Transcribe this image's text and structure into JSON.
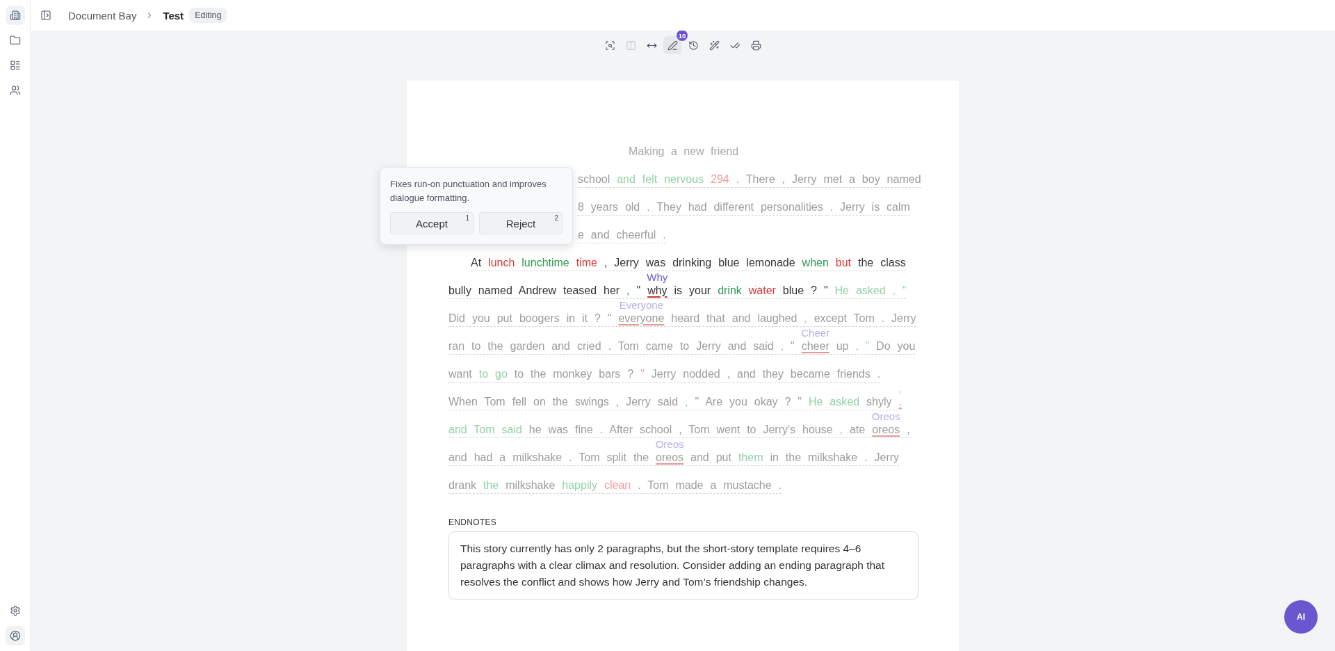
{
  "sidebar": {
    "items": [
      {
        "kind": "building",
        "selected": true
      },
      {
        "kind": "folder",
        "selected": false
      },
      {
        "kind": "layout",
        "selected": false
      },
      {
        "kind": "users",
        "selected": false
      }
    ],
    "bottom_items": [
      {
        "kind": "settings",
        "selected": false
      },
      {
        "kind": "account",
        "selected": true
      }
    ]
  },
  "header": {
    "breadcrumb": [
      "Document Bay",
      "Test"
    ],
    "status": "Editing"
  },
  "toolbar": [
    {
      "kind": "image-search",
      "selected": false,
      "disabled": false
    },
    {
      "kind": "columns",
      "selected": false,
      "disabled": true
    },
    {
      "kind": "width",
      "selected": false,
      "disabled": false
    },
    {
      "kind": "pen",
      "selected": true,
      "disabled": false,
      "badge": "10"
    },
    {
      "kind": "history",
      "selected": false,
      "disabled": false
    },
    {
      "kind": "wand",
      "selected": false,
      "disabled": false
    },
    {
      "kind": "check",
      "selected": false,
      "disabled": false
    },
    {
      "kind": "print",
      "selected": false,
      "disabled": false
    }
  ],
  "document": {
    "title": {
      "text": "Making a new friend",
      "active": false
    },
    "paragraphs": [
      {
        "kind": "partly_covered",
        "lines": [
          {
            "segments": [
              {
                "active": false,
                "tokens": [
                  {
                    "kind": "text",
                    "text": "school"
                  },
                  {
                    "kind": "insert",
                    "text": "and felt nervous"
                  },
                  {
                    "kind": "delete",
                    "text": "294"
                  },
                  {
                    "kind": "text",
                    "text": ". There , Jerry met a boy named"
                  }
                ]
              }
            ]
          },
          {
            "segments": [
              {
                "active": false,
                "tokens": [
                  {
                    "kind": "text",
                    "text": "8 years old . They had different personalities . Jerry is calm"
                  }
                ]
              }
            ]
          },
          {
            "segments": [
              {
                "active": false,
                "tokens": [
                  {
                    "kind": "text",
                    "text": "e and cheerful ."
                  }
                ]
              }
            ]
          }
        ]
      },
      {
        "kind": "indented",
        "lines": [
          {
            "segments": [
              {
                "active": true,
                "tokens": [
                  {
                    "kind": "text",
                    "text": "At"
                  },
                  {
                    "kind": "delete",
                    "text": "lunch"
                  },
                  {
                    "kind": "insert",
                    "text": "lunchtime"
                  },
                  {
                    "kind": "delete",
                    "text": "time"
                  },
                  {
                    "kind": "text",
                    "text": ", Jerry was drinking blue lemonade"
                  },
                  {
                    "kind": "insert",
                    "text": "when"
                  },
                  {
                    "kind": "delete",
                    "text": "but"
                  },
                  {
                    "kind": "text",
                    "text": "the class"
                  }
                ]
              }
            ]
          },
          {
            "segments": [
              {
                "active": true,
                "tokens": [
                  {
                    "kind": "text",
                    "text": "bully named Andrew teased her"
                  },
                  {
                    "kind": "insert",
                    "text": ","
                  },
                  {
                    "kind": "text",
                    "text": "\""
                  },
                  {
                    "kind": "replace",
                    "text": "why",
                    "suggestion": "Why"
                  },
                  {
                    "kind": "text",
                    "text": "is your"
                  },
                  {
                    "kind": "insert",
                    "text": "drink"
                  },
                  {
                    "kind": "delete",
                    "text": "water"
                  },
                  {
                    "kind": "text",
                    "text": "blue ? \""
                  }
                ]
              },
              {
                "active": false,
                "tokens": [
                  {
                    "kind": "insert",
                    "text": "He asked , “"
                  }
                ]
              }
            ]
          },
          {
            "segments": [
              {
                "active": false,
                "tokens": [
                  {
                    "kind": "text",
                    "text": "Did you put boogers in it ? \""
                  },
                  {
                    "kind": "replace",
                    "text": "everyone",
                    "suggestion": "Everyone"
                  },
                  {
                    "kind": "text",
                    "text": "heard that and laughed"
                  },
                  {
                    "kind": "insert",
                    "text": ","
                  },
                  {
                    "kind": "text",
                    "text": "except Tom . Jerry"
                  }
                ]
              }
            ]
          },
          {
            "segments": [
              {
                "active": false,
                "tokens": [
                  {
                    "kind": "text",
                    "text": "ran to the garden and cried . Tom came to Jerry and said"
                  },
                  {
                    "kind": "insert",
                    "text": ","
                  },
                  {
                    "kind": "text",
                    "text": "\""
                  },
                  {
                    "kind": "replace",
                    "text": "cheer",
                    "suggestion": "Cheer"
                  },
                  {
                    "kind": "text",
                    "text": "up ."
                  },
                  {
                    "kind": "insert",
                    "text": "”"
                  },
                  {
                    "kind": "text",
                    "text": "Do you"
                  }
                ]
              }
            ]
          },
          {
            "segments": [
              {
                "active": false,
                "tokens": [
                  {
                    "kind": "text",
                    "text": "want"
                  },
                  {
                    "kind": "insert",
                    "text": "to go"
                  },
                  {
                    "kind": "text",
                    "text": "to the monkey bars ?"
                  },
                  {
                    "kind": "delete",
                    "text": "\""
                  },
                  {
                    "kind": "text",
                    "text": "Jerry nodded , and they became friends ."
                  }
                ]
              }
            ]
          },
          {
            "segments": [
              {
                "active": false,
                "tokens": [
                  {
                    "kind": "text",
                    "text": "When Tom fell on the swings , Jerry said"
                  },
                  {
                    "kind": "insert",
                    "text": ","
                  },
                  {
                    "kind": "text",
                    "text": "\" Are you okay ? \""
                  },
                  {
                    "kind": "insert",
                    "text": "He asked"
                  },
                  {
                    "kind": "text",
                    "text": "shyly"
                  },
                  {
                    "kind": "replace",
                    "text": ".",
                    "suggestion": ","
                  }
                ]
              }
            ]
          },
          {
            "segments": [
              {
                "active": false,
                "tokens": [
                  {
                    "kind": "insert",
                    "text": "and Tom said"
                  },
                  {
                    "kind": "text",
                    "text": "he was fine . After school , Tom went to Jerry's house"
                  },
                  {
                    "kind": "insert",
                    "text": ","
                  },
                  {
                    "kind": "text",
                    "text": "ate"
                  },
                  {
                    "kind": "replace",
                    "text": "oreos",
                    "suggestion": "Oreos"
                  },
                  {
                    "kind": "text",
                    "text": ","
                  }
                ]
              }
            ]
          },
          {
            "segments": [
              {
                "active": false,
                "tokens": [
                  {
                    "kind": "text",
                    "text": "and had a milkshake . Tom split the"
                  },
                  {
                    "kind": "replace",
                    "text": "oreos",
                    "suggestion": "Oreos"
                  },
                  {
                    "kind": "text",
                    "text": "and put"
                  },
                  {
                    "kind": "insert",
                    "text": "them"
                  },
                  {
                    "kind": "text",
                    "text": "in the milkshake . Jerry"
                  }
                ]
              }
            ]
          },
          {
            "segments": [
              {
                "active": false,
                "tokens": [
                  {
                    "kind": "text",
                    "text": "drank"
                  },
                  {
                    "kind": "insert",
                    "text": "the"
                  },
                  {
                    "kind": "text",
                    "text": "milkshake"
                  },
                  {
                    "kind": "insert",
                    "text": "happily"
                  },
                  {
                    "kind": "delete",
                    "text": "clean"
                  },
                  {
                    "kind": "text",
                    "text": ". Tom made a mustache ."
                  }
                ]
              }
            ]
          }
        ]
      }
    ]
  },
  "popup": {
    "text": "Fixes run-on punctuation and improves dialogue formatting.",
    "buttons": [
      {
        "label": "Accept",
        "shortcut": "1"
      },
      {
        "label": "Reject",
        "shortcut": "2"
      }
    ]
  },
  "endnotes": {
    "label": "ENDNOTES",
    "text": "This story currently has only 2 paragraphs, but the short-story template requires 4–6 paragraphs with a clear climax and resolution. Consider adding an ending paragraph that resolves the conflict and shows how Jerry and Tom’s friendship changes."
  },
  "assistant_button": {
    "label": "AI"
  }
}
